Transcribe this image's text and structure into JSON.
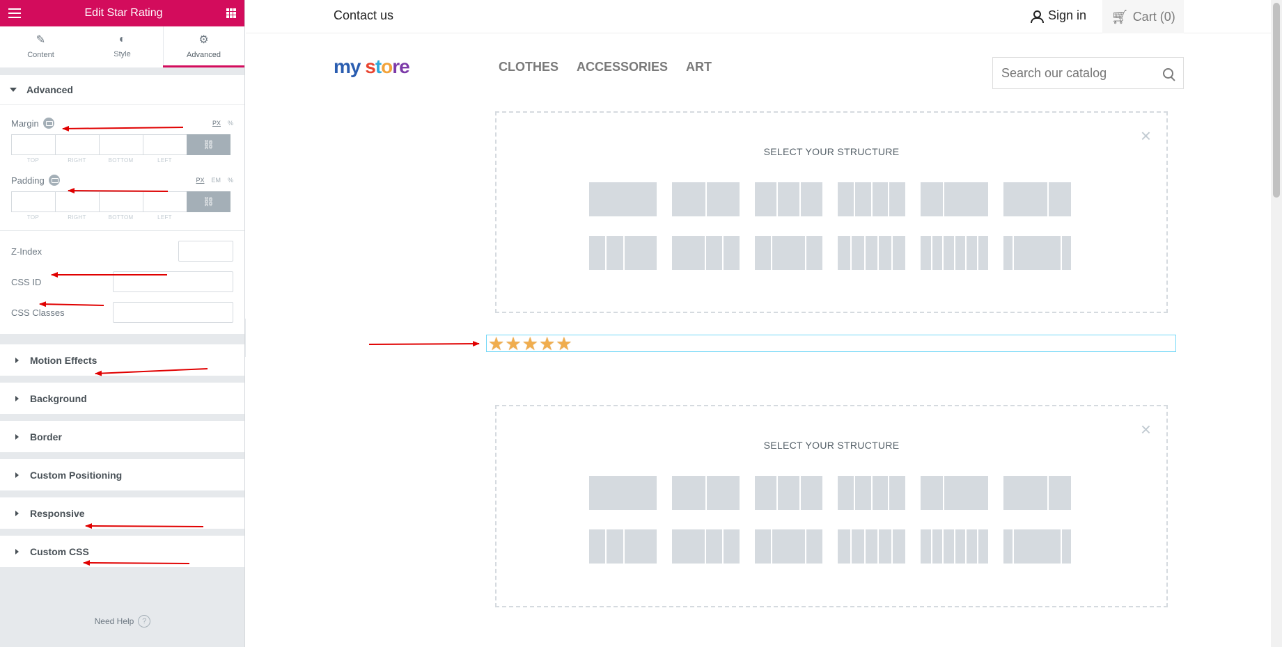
{
  "panel": {
    "title": "Edit Star Rating",
    "tabs": [
      {
        "label": "Content",
        "icon": "pencil-icon"
      },
      {
        "label": "Style",
        "icon": "contrast-icon"
      },
      {
        "label": "Advanced",
        "icon": "gear-icon",
        "active": true
      }
    ],
    "advanced": {
      "title": "Advanced",
      "margin_label": "Margin",
      "margin_units": [
        "PX",
        "%"
      ],
      "padding_label": "Padding",
      "padding_units": [
        "PX",
        "EM",
        "%"
      ],
      "dim_labels": [
        "TOP",
        "RIGHT",
        "BOTTOM",
        "LEFT"
      ],
      "zindex_label": "Z-Index",
      "cssid_label": "CSS ID",
      "cssclasses_label": "CSS Classes"
    },
    "collapsed_sections": [
      "Motion Effects",
      "Background",
      "Border",
      "Custom Positioning",
      "Responsive",
      "Custom CSS"
    ],
    "need_help": "Need Help",
    "accent_color": "#d30c5c"
  },
  "preview": {
    "contact": "Contact us",
    "signin": "Sign in",
    "cart": "Cart (0)",
    "logo_parts": [
      "my ",
      "s",
      "t",
      "o",
      "re"
    ],
    "nav": [
      "CLOTHES",
      "ACCESSORIES",
      "ART"
    ],
    "search_placeholder": "Search our catalog",
    "structure_title": "SELECT YOUR STRUCTURE",
    "rating": {
      "value": 5,
      "max": 5,
      "color": "#f0ad4e"
    }
  }
}
